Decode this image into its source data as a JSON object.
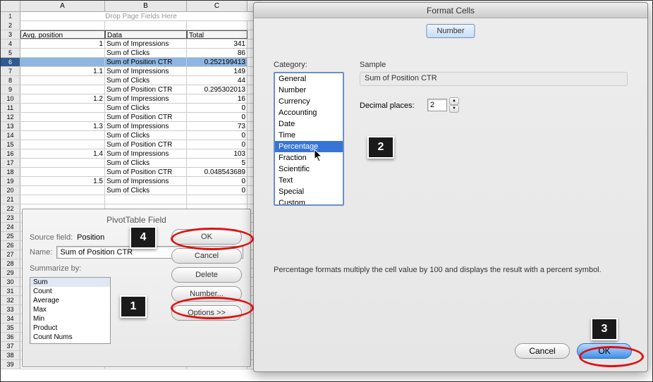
{
  "spreadsheet": {
    "columns": [
      "A",
      "B",
      "C"
    ],
    "page_fields_hint": "Drop Page Fields Here",
    "header": {
      "a": "Avg. position",
      "b": "Data",
      "c": "Total"
    },
    "rows": [
      {
        "n": 4,
        "a": "1",
        "b": "Sum of Impressions",
        "c": "341"
      },
      {
        "n": 5,
        "a": "",
        "b": "Sum of Clicks",
        "c": "86"
      },
      {
        "n": 6,
        "a": "",
        "b": "Sum of Position CTR",
        "c": "0.252199413",
        "selected": true
      },
      {
        "n": 7,
        "a": "1.1",
        "b": "Sum of Impressions",
        "c": "149"
      },
      {
        "n": 8,
        "a": "",
        "b": "Sum of Clicks",
        "c": "44"
      },
      {
        "n": 9,
        "a": "",
        "b": "Sum of Position CTR",
        "c": "0.295302013"
      },
      {
        "n": 10,
        "a": "1.2",
        "b": "Sum of Impressions",
        "c": "16"
      },
      {
        "n": 11,
        "a": "",
        "b": "Sum of Clicks",
        "c": "0"
      },
      {
        "n": 12,
        "a": "",
        "b": "Sum of Position CTR",
        "c": "0"
      },
      {
        "n": 13,
        "a": "1.3",
        "b": "Sum of Impressions",
        "c": "73"
      },
      {
        "n": 14,
        "a": "",
        "b": "Sum of Clicks",
        "c": "0"
      },
      {
        "n": 15,
        "a": "",
        "b": "Sum of Position CTR",
        "c": "0"
      },
      {
        "n": 16,
        "a": "1.4",
        "b": "Sum of Impressions",
        "c": "103"
      },
      {
        "n": 17,
        "a": "",
        "b": "Sum of Clicks",
        "c": "5"
      },
      {
        "n": 18,
        "a": "",
        "b": "Sum of Position CTR",
        "c": "0.048543689"
      },
      {
        "n": 19,
        "a": "1.5",
        "b": "Sum of Impressions",
        "c": "0"
      },
      {
        "n": 20,
        "a": "",
        "b": "Sum of Clicks",
        "c": "0"
      }
    ],
    "empty_rows": [
      21,
      22,
      23,
      24,
      25,
      26,
      27,
      28,
      29,
      30,
      31,
      32,
      33,
      34,
      35,
      36,
      37,
      38,
      39
    ]
  },
  "pivot_field": {
    "title": "PivotTable Field",
    "source_field_label": "Source field:",
    "source_field_value": "Position",
    "name_label": "Name:",
    "name_value": "Sum of Position CTR",
    "summarize_label": "Summarize by:",
    "summarize_options": [
      "Sum",
      "Count",
      "Average",
      "Max",
      "Min",
      "Product",
      "Count Nums"
    ],
    "summarize_selected": "Sum",
    "buttons": {
      "ok": "OK",
      "cancel": "Cancel",
      "delete": "Delete",
      "number": "Number...",
      "options": "Options >>"
    }
  },
  "format_cells": {
    "title": "Format Cells",
    "tab": "Number",
    "category_label": "Category:",
    "categories": [
      "General",
      "Number",
      "Currency",
      "Accounting",
      "Date",
      "Time",
      "Percentage",
      "Fraction",
      "Scientific",
      "Text",
      "Special",
      "Custom"
    ],
    "category_selected": "Percentage",
    "sample_label": "Sample",
    "sample_value": "Sum of Position CTR",
    "decimal_label": "Decimal places:",
    "decimal_value": "2",
    "description": "Percentage formats multiply the cell value by 100 and displays the result with a percent symbol.",
    "buttons": {
      "cancel": "Cancel",
      "ok": "OK"
    }
  },
  "callouts": {
    "c1": "1",
    "c2": "2",
    "c3": "3",
    "c4": "4"
  }
}
